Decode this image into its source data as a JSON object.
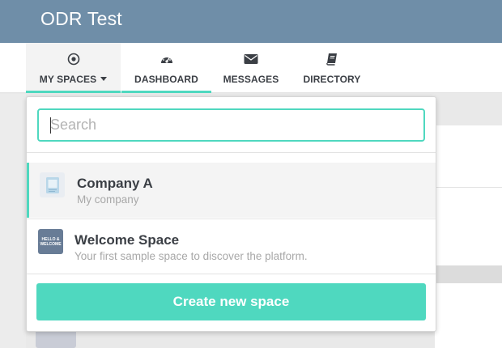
{
  "app": {
    "title": "ODR Test"
  },
  "nav": {
    "items": [
      {
        "label": "MY SPACES",
        "icon": "target-icon"
      },
      {
        "label": "DASHBOARD",
        "icon": "dashboard-gauge-icon"
      },
      {
        "label": "MESSAGES",
        "icon": "envelope-icon"
      },
      {
        "label": "DIRECTORY",
        "icon": "book-icon"
      }
    ]
  },
  "dropdown": {
    "search": {
      "placeholder": "Search",
      "value": ""
    },
    "spaces": [
      {
        "name": "Company A",
        "description": "My company",
        "thumb_icon": "document-icon"
      },
      {
        "name": "Welcome Space",
        "description": "Your first sample space to discover the platform.",
        "thumb_text": "HELLO & WELCOME"
      }
    ],
    "create_label": "Create new space"
  },
  "colors": {
    "header_bg": "#6f8ea8",
    "accent": "#4fd8bf",
    "text_dark": "#3b3f45",
    "text_muted": "#a8a8a8"
  }
}
